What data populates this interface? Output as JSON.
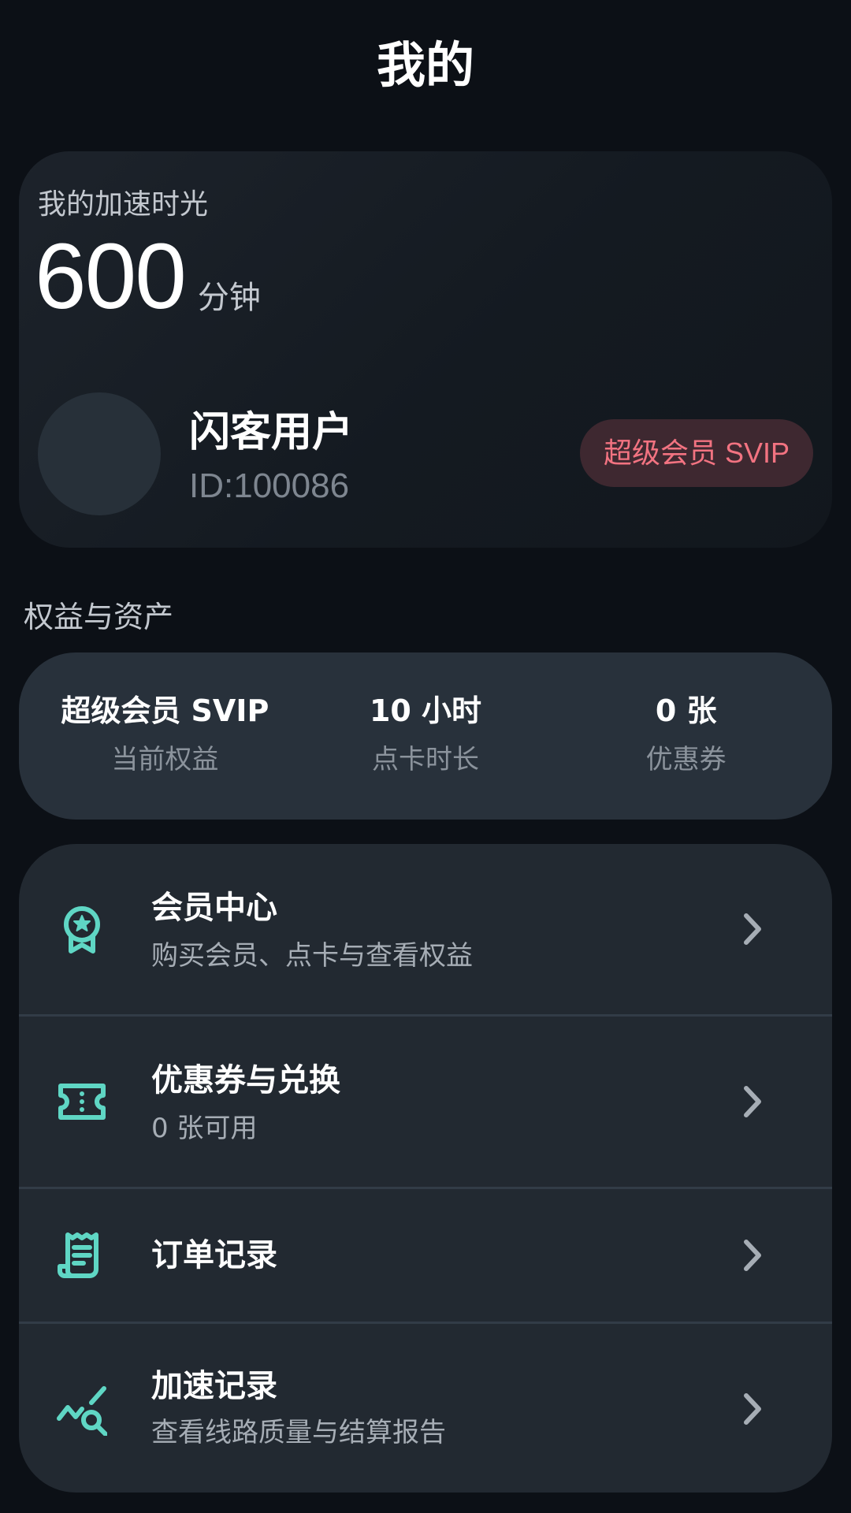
{
  "header": {
    "title": "我的"
  },
  "time_card": {
    "label": "我的加速时光",
    "value": "600",
    "unit": "分钟"
  },
  "user": {
    "name": "闪客用户",
    "id": "ID:100086",
    "badge": "超级会员 SVIP"
  },
  "assets_section": {
    "title": "权益与资产",
    "items": [
      {
        "value": "超级会员 SVIP",
        "label": "当前权益"
      },
      {
        "value": "10 小时",
        "label": "点卡时长"
      },
      {
        "value": "0 张",
        "label": "优惠券"
      }
    ]
  },
  "menu": [
    {
      "icon": "award-icon",
      "title": "会员中心",
      "subtitle": "购买会员、点卡与查看权益"
    },
    {
      "icon": "ticket-icon",
      "title": "优惠券与兑换",
      "subtitle": "0 张可用"
    },
    {
      "icon": "receipt-icon",
      "title": "订单记录",
      "subtitle": ""
    },
    {
      "icon": "analytics-search-icon",
      "title": "加速记录",
      "subtitle": "查看线路质量与结算报告"
    }
  ],
  "colors": {
    "background": "#0c1016",
    "accent": "#5fd6c4",
    "badge_text": "#f27381",
    "badge_bg": "#3e2830"
  }
}
